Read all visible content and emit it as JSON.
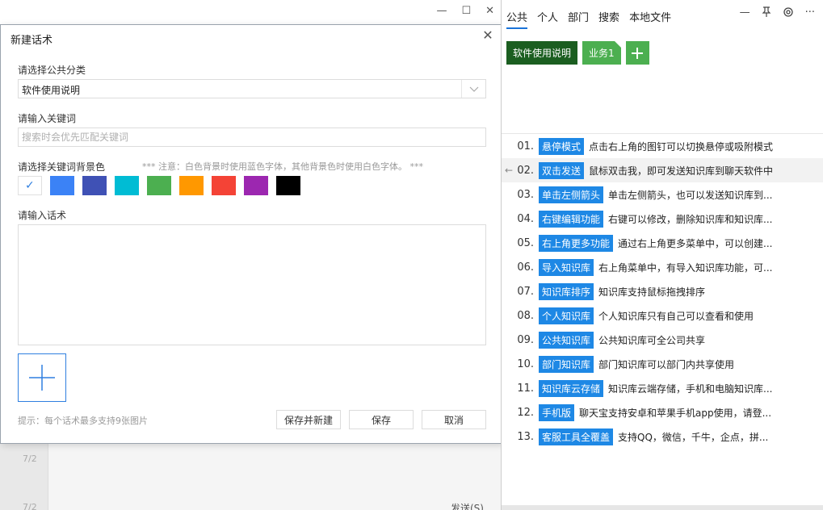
{
  "background": {
    "time1": "7/2",
    "time2": "7/2",
    "send_label": "发送(S)"
  },
  "dialog": {
    "title": "新建话术",
    "category_label": "请选择公共分类",
    "category_value": "软件使用说明",
    "keyword_label": "请输入关键词",
    "keyword_placeholder": "搜索时会优先匹配关键词",
    "color_label": "请选择关键词背景色",
    "color_note": "*** 注意：白色背景时使用蓝色字体，其他背景色时使用白色字体。 ***",
    "colors": [
      "#ffffff",
      "#3b82f6",
      "#3f51b5",
      "#00bcd4",
      "#4caf50",
      "#ff9800",
      "#f44336",
      "#9c27b0",
      "#000000"
    ],
    "selected_color": "#ffffff",
    "content_label": "请输入话术",
    "hint": "提示：每个话术最多支持9张图片",
    "buttons": {
      "save_new": "保存并新建",
      "save": "保存",
      "cancel": "取消"
    }
  },
  "panel": {
    "tabs": [
      "公共",
      "个人",
      "部门",
      "搜索",
      "本地文件"
    ],
    "active_tab": "公共",
    "categories": [
      "软件使用说明",
      "业务1"
    ],
    "items": [
      {
        "num": "01.",
        "keyword": "悬停模式",
        "text": "点击右上角的图钉可以切换悬停或吸附模式"
      },
      {
        "num": "02.",
        "keyword": "双击发送",
        "text": "鼠标双击我，即可发送知识库到聊天软件中"
      },
      {
        "num": "03.",
        "keyword": "单击左侧箭头",
        "text": "单击左侧箭头，也可以发送知识库到..."
      },
      {
        "num": "04.",
        "keyword": "右键编辑功能",
        "text": "右键可以修改，删除知识库和知识库..."
      },
      {
        "num": "05.",
        "keyword": "右上角更多功能",
        "text": "通过右上角更多菜单中，可以创建..."
      },
      {
        "num": "06.",
        "keyword": "导入知识库",
        "text": "右上角菜单中，有导入知识库功能，可..."
      },
      {
        "num": "07.",
        "keyword": "知识库排序",
        "text": "知识库支持鼠标拖拽排序"
      },
      {
        "num": "08.",
        "keyword": "个人知识库",
        "text": "个人知识库只有自己可以查看和使用"
      },
      {
        "num": "09.",
        "keyword": "公共知识库",
        "text": "公共知识库可全公司共享"
      },
      {
        "num": "10.",
        "keyword": "部门知识库",
        "text": "部门知识库可以部门内共享使用"
      },
      {
        "num": "11.",
        "keyword": "知识库云存储",
        "text": "知识库云端存储，手机和电脑知识库..."
      },
      {
        "num": "12.",
        "keyword": "手机版",
        "text": "聊天宝支持安卓和苹果手机app使用，请登..."
      },
      {
        "num": "13.",
        "keyword": "客服工具全覆盖",
        "text": "支持QQ，微信，千牛，企点，拼..."
      }
    ],
    "hover_index": 1
  }
}
